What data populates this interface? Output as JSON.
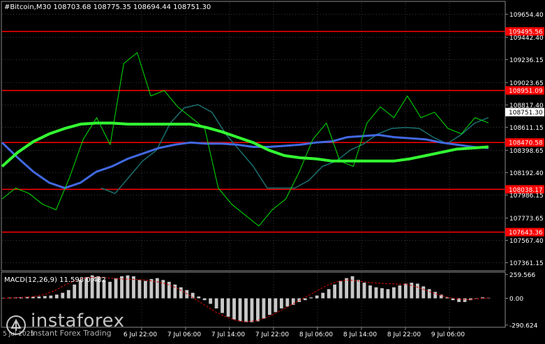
{
  "chart_data": [
    {
      "type": "line",
      "title": "#Bitcoin,M30  108703.68 108775.35 108694.44 108751.30",
      "x": [
        "6 Jul 22:00",
        "7 Jul 06:00",
        "7 Jul 14:00",
        "7 Jul 22:00",
        "8 Jul 06:00",
        "8 Jul 14:00",
        "8 Jul 22:00",
        "9 Jul 06:00"
      ],
      "ylim": [
        107300,
        109760
      ],
      "y_ticks": [
        "109654.40",
        "109442.40",
        "109236.15",
        "109023.65",
        "108817.40",
        "108611.15",
        "108398.65",
        "108192.40",
        "107986.15",
        "107773.65",
        "107567.40",
        "107361.15"
      ],
      "current_price": "108751.30",
      "levels": [
        {
          "label": "109495.56",
          "value": 109495.56
        },
        {
          "label": "108951.09",
          "value": 108951.09
        },
        {
          "label": "108470.58",
          "value": 108470.58
        },
        {
          "label": "108038.17",
          "value": 108038.17
        },
        {
          "label": "107643.36",
          "value": 107643.36
        }
      ],
      "series": [
        {
          "role": "price",
          "color": "#00e400",
          "values": [
            107950,
            108050,
            108000,
            107900,
            107850,
            108150,
            108500,
            108700,
            108450,
            109200,
            109300,
            108900,
            108950,
            108800,
            108700,
            108600,
            108050,
            107900,
            107800,
            107700,
            107850,
            107950,
            108200,
            108500,
            108650,
            108300,
            108250,
            108650,
            108800,
            108700,
            108900,
            108700,
            108750,
            108600,
            108550,
            108700,
            108651
          ]
        },
        {
          "role": "ma-green",
          "color": "#33ff33",
          "values": [
            108250,
            108380,
            108480,
            108550,
            108600,
            108640,
            108650,
            108650,
            108640,
            108640,
            108640,
            108640,
            108640,
            108610,
            108570,
            108520,
            108470,
            108400,
            108350,
            108330,
            108320,
            108300,
            108300,
            108300,
            108300,
            108300,
            108320,
            108350,
            108380,
            108410,
            108420,
            108430
          ]
        },
        {
          "role": "ma-blue",
          "color": "#4169e1",
          "values": [
            108470,
            108330,
            108200,
            108100,
            108050,
            108100,
            108200,
            108250,
            108320,
            108370,
            108420,
            108450,
            108470,
            108460,
            108460,
            108450,
            108430,
            108430,
            108440,
            108450,
            108470,
            108480,
            108520,
            108530,
            108540,
            108520,
            108510,
            108500,
            108470,
            108450,
            108430,
            108420
          ]
        },
        {
          "role": "ma-teal",
          "color": "#1b7070",
          "values": [
            108050,
            108000,
            108150,
            108300,
            108400,
            108650,
            108790,
            108820,
            108750,
            108550,
            108400,
            108250,
            108050,
            108050,
            108050,
            108120,
            108250,
            108300,
            108400,
            108460,
            108550,
            108600,
            108610,
            108600,
            108520,
            108460,
            108540,
            108650,
            108700
          ]
        }
      ]
    },
    {
      "type": "bar",
      "title": "MACD(12,26,9) 11.598 0.482",
      "y_ticks": [
        "259.566",
        "0.00",
        "-290.624"
      ],
      "ylim": [
        -300,
        270
      ],
      "series": [
        {
          "role": "histogram",
          "color": "#c8c8c8",
          "values": [
            5,
            8,
            10,
            12,
            15,
            18,
            20,
            25,
            30,
            40,
            60,
            90,
            150,
            200,
            230,
            250,
            240,
            200,
            180,
            220,
            240,
            250,
            240,
            200,
            190,
            210,
            220,
            200,
            180,
            150,
            120,
            90,
            60,
            20,
            -20,
            -60,
            -110,
            -160,
            -200,
            -230,
            -250,
            -260,
            -260,
            -250,
            -220,
            -180,
            -150,
            -110,
            -90,
            -70,
            -40,
            -20,
            10,
            30,
            60,
            100,
            150,
            190,
            220,
            240,
            200,
            170,
            140,
            120,
            110,
            100,
            120,
            140,
            160,
            170,
            160,
            130,
            100,
            70,
            40,
            10,
            -20,
            -40,
            -40,
            -20,
            0,
            10,
            5
          ]
        },
        {
          "role": "signal",
          "color": "#e00000",
          "values": [
            0,
            5,
            10,
            20,
            40,
            80,
            140,
            190,
            220,
            230,
            225,
            215,
            210,
            205,
            200,
            185,
            160,
            120,
            60,
            -10,
            -80,
            -150,
            -200,
            -240,
            -255,
            -245,
            -210,
            -160,
            -100,
            -40,
            20,
            80,
            140,
            180,
            200,
            190,
            175,
            165,
            160,
            155,
            150,
            120,
            80,
            40,
            10,
            -10,
            -15,
            -5,
            5
          ]
        }
      ]
    }
  ],
  "x_start_label": "5 Jul 2025",
  "watermark": {
    "brand": "instaforex",
    "tagline": "Instant Forex Trading"
  }
}
